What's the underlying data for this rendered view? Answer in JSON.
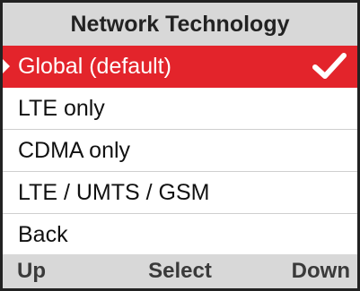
{
  "header": {
    "title": "Network Technology"
  },
  "menu": {
    "items": [
      {
        "label": "Global (default)",
        "selected": true,
        "checked": true
      },
      {
        "label": "LTE only",
        "selected": false,
        "checked": false
      },
      {
        "label": "CDMA only",
        "selected": false,
        "checked": false
      },
      {
        "label": "LTE / UMTS / GSM",
        "selected": false,
        "checked": false
      },
      {
        "label": "Back",
        "selected": false,
        "checked": false
      }
    ]
  },
  "softkeys": {
    "left": "Up",
    "center": "Select",
    "right": "Down"
  },
  "colors": {
    "selection": "#e3242b",
    "bar": "#d8d8d8"
  },
  "icons": {
    "selected_marker": "pointer-arrow-icon",
    "checked_marker": "checkmark-icon"
  }
}
